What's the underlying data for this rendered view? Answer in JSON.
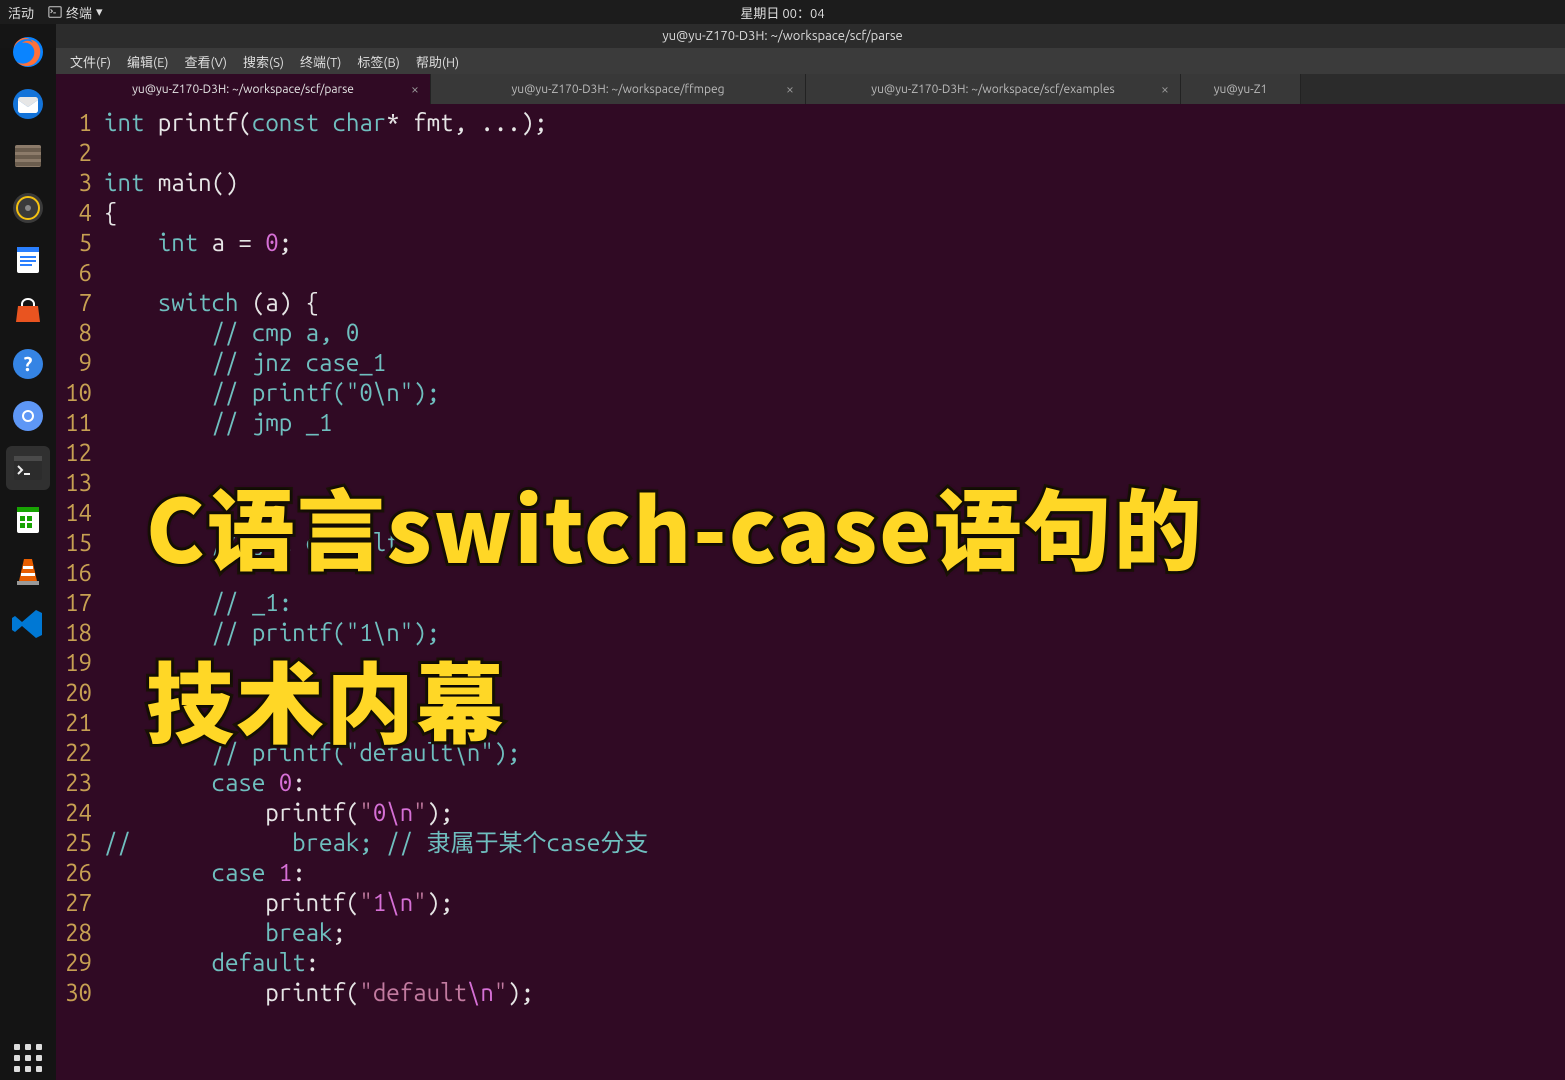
{
  "top_panel": {
    "activities": "活动",
    "app_indicator": "终端",
    "clock": "星期日 00：04"
  },
  "title_bar": "yu@yu-Z170-D3H: ~/workspace/scf/parse",
  "dock": {
    "items": [
      {
        "name": "firefox"
      },
      {
        "name": "thunderbird"
      },
      {
        "name": "files"
      },
      {
        "name": "rhythmbox"
      },
      {
        "name": "writer"
      },
      {
        "name": "software"
      },
      {
        "name": "help"
      },
      {
        "name": "chromium"
      },
      {
        "name": "terminal",
        "active": true
      },
      {
        "name": "calc"
      },
      {
        "name": "vlc"
      },
      {
        "name": "vscode"
      }
    ]
  },
  "menu": {
    "file": "文件(F)",
    "edit": "编辑(E)",
    "view": "查看(V)",
    "search": "搜索(S)",
    "terminal": "终端(T)",
    "tabs": "标签(B)",
    "help": "帮助(H)"
  },
  "tabs": [
    {
      "title": "yu@yu-Z170-D3H: ~/workspace/scf/parse",
      "active": true
    },
    {
      "title": "yu@yu-Z170-D3H: ~/workspace/ffmpeg",
      "active": false
    },
    {
      "title": "yu@yu-Z170-D3H: ~/workspace/scf/examples",
      "active": false
    },
    {
      "title": "yu@yu-Z1",
      "active": false,
      "partial": true
    }
  ],
  "overlay": {
    "line1": "C语言switch-case语句的",
    "line2": "技术内幕"
  },
  "code_lines": [
    {
      "n": 1,
      "t": [
        [
          "ty",
          "int"
        ],
        [
          "op",
          " "
        ],
        [
          "fn",
          "printf"
        ],
        [
          "op",
          "("
        ],
        [
          "kw",
          "const"
        ],
        [
          "op",
          " "
        ],
        [
          "ty",
          "char"
        ],
        [
          "op",
          "* fmt, ...);"
        ]
      ]
    },
    {
      "n": 2,
      "t": []
    },
    {
      "n": 3,
      "t": [
        [
          "ty",
          "int"
        ],
        [
          "op",
          " "
        ],
        [
          "fn",
          "main"
        ],
        [
          "op",
          "()"
        ]
      ]
    },
    {
      "n": 4,
      "t": [
        [
          "op",
          "{"
        ]
      ]
    },
    {
      "n": 5,
      "t": [
        [
          "op",
          "    "
        ],
        [
          "ty",
          "int"
        ],
        [
          "op",
          " a = "
        ],
        [
          "num",
          "0"
        ],
        [
          "op",
          ";"
        ]
      ]
    },
    {
      "n": 6,
      "t": []
    },
    {
      "n": 7,
      "t": [
        [
          "op",
          "    "
        ],
        [
          "kw",
          "switch"
        ],
        [
          "op",
          " (a) {"
        ]
      ]
    },
    {
      "n": 8,
      "t": [
        [
          "op",
          "        "
        ],
        [
          "cm",
          "// cmp a, 0"
        ]
      ]
    },
    {
      "n": 9,
      "t": [
        [
          "op",
          "        "
        ],
        [
          "cm",
          "// jnz case_1"
        ]
      ]
    },
    {
      "n": 10,
      "t": [
        [
          "op",
          "        "
        ],
        [
          "cm",
          "// printf(\"0\\n\");"
        ]
      ]
    },
    {
      "n": 11,
      "t": [
        [
          "op",
          "        "
        ],
        [
          "cm",
          "// jmp _1"
        ]
      ]
    },
    {
      "n": 12,
      "t": []
    },
    {
      "n": 13,
      "t": []
    },
    {
      "n": 14,
      "t": []
    },
    {
      "n": 15,
      "t": [
        [
          "op",
          "        "
        ],
        [
          "cm",
          "// jnz default"
        ]
      ]
    },
    {
      "n": 16,
      "t": []
    },
    {
      "n": 17,
      "t": [
        [
          "op",
          "        "
        ],
        [
          "cm",
          "// _1:"
        ]
      ]
    },
    {
      "n": 18,
      "t": [
        [
          "op",
          "        "
        ],
        [
          "cm",
          "// printf(\"1\\n\");"
        ]
      ]
    },
    {
      "n": 19,
      "t": []
    },
    {
      "n": 20,
      "t": []
    },
    {
      "n": 21,
      "t": []
    },
    {
      "n": 22,
      "t": [
        [
          "op",
          "        "
        ],
        [
          "cm",
          "// printf(\"default\\n\");"
        ]
      ]
    },
    {
      "n": 23,
      "t": [
        [
          "op",
          "        "
        ],
        [
          "kw",
          "case"
        ],
        [
          "op",
          " "
        ],
        [
          "num",
          "0"
        ],
        [
          "op",
          ":"
        ]
      ]
    },
    {
      "n": 24,
      "t": [
        [
          "op",
          "            "
        ],
        [
          "fn",
          "printf"
        ],
        [
          "op",
          "("
        ],
        [
          "str",
          "\""
        ],
        [
          "num",
          "0"
        ],
        [
          "esc",
          "\\n"
        ],
        [
          "str",
          "\""
        ],
        [
          "op",
          ");"
        ]
      ]
    },
    {
      "n": 25,
      "t": [
        [
          "cm2",
          "//            break; // "
        ],
        [
          "cjk",
          "隶属于某个case分支"
        ]
      ]
    },
    {
      "n": 26,
      "t": [
        [
          "op",
          "        "
        ],
        [
          "kw",
          "case"
        ],
        [
          "op",
          " "
        ],
        [
          "num",
          "1"
        ],
        [
          "op",
          ":"
        ]
      ]
    },
    {
      "n": 27,
      "t": [
        [
          "op",
          "            "
        ],
        [
          "fn",
          "printf"
        ],
        [
          "op",
          "("
        ],
        [
          "str",
          "\""
        ],
        [
          "num",
          "1"
        ],
        [
          "esc",
          "\\n"
        ],
        [
          "str",
          "\""
        ],
        [
          "op",
          ");"
        ]
      ]
    },
    {
      "n": 28,
      "t": [
        [
          "op",
          "            "
        ],
        [
          "kw",
          "break"
        ],
        [
          "op",
          ";"
        ]
      ]
    },
    {
      "n": 29,
      "t": [
        [
          "op",
          "        "
        ],
        [
          "kw",
          "default"
        ],
        [
          "op",
          ":"
        ]
      ]
    },
    {
      "n": 30,
      "t": [
        [
          "op",
          "            "
        ],
        [
          "fn",
          "printf"
        ],
        [
          "op",
          "("
        ],
        [
          "str",
          "\""
        ],
        [
          "str",
          "default"
        ],
        [
          "esc",
          "\\n"
        ],
        [
          "str",
          "\""
        ],
        [
          "op",
          ");"
        ]
      ]
    }
  ]
}
